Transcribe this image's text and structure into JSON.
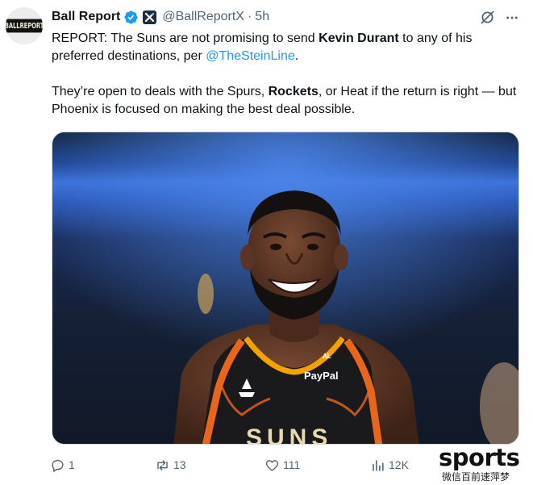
{
  "account": {
    "display_name": "Ball Report",
    "handle": "@BallReportX",
    "separator": "·",
    "time": "5h",
    "avatar_text": "BALLREPORT"
  },
  "tweet": {
    "line1_prefix": "REPORT: The Suns are not promising to send ",
    "line1_bold": "Kevin Durant",
    "line1_middle": " to any of his preferred destinations, per ",
    "line1_mention": "@TheSteinLine",
    "line1_suffix": ".",
    "line2_prefix": "They’re open to deals with the Spurs, ",
    "line2_bold": "Rockets",
    "line2_suffix": ", or Heat if the return is right — but Phoenix is focused on making the best deal possible."
  },
  "media": {
    "jersey_sponsor": "PayPal",
    "jersey_tag": "AL",
    "jersey_text": "SUNS"
  },
  "actions": {
    "replies": "1",
    "reposts": "13",
    "likes": "111",
    "views": "12K"
  },
  "watermark": {
    "main": "sports",
    "sub": "微信百前速萍梦"
  },
  "colors": {
    "link": "#1d9bf0",
    "secondary": "#536471",
    "verified": "#1d9bf0"
  },
  "icons": [
    "verified-icon",
    "affiliate-badge-icon",
    "grok-icon",
    "more-icon",
    "reply-icon",
    "repost-icon",
    "like-icon",
    "views-icon"
  ]
}
